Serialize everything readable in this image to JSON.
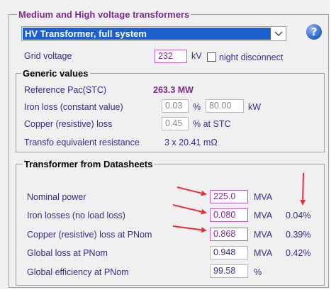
{
  "main_group": {
    "title": "Medium and High voltage transformers",
    "selected_transformer": "HV Transformer, full system",
    "grid_voltage_label": "Grid voltage",
    "grid_voltage_value": "232",
    "grid_voltage_unit": "kV",
    "night_disconnect_label": "night disconnect",
    "night_disconnect_checked": false,
    "help_glyph": "?"
  },
  "generic_values": {
    "title": "Generic values",
    "reference_pac_label": "Reference Pac(STC)",
    "reference_pac_value": "263.3 MW",
    "iron_loss_label": "Iron loss (constant value)",
    "iron_loss_pct": "0.03",
    "iron_loss_pct_unit": "%",
    "iron_loss_kw": "80.00",
    "iron_loss_kw_unit": "kW",
    "copper_loss_label": "Copper (resistive) loss",
    "copper_loss_pct": "0.45",
    "copper_loss_unit": "% at STC",
    "transfo_resistance_label": "Transfo equivalent resistance",
    "transfo_resistance_value": "3 x 20.41 mΩ"
  },
  "datasheets": {
    "title": "Transformer from Datasheets",
    "rows": [
      {
        "label": "Nominal power",
        "value": "225.0",
        "unit": "MVA",
        "pct": ""
      },
      {
        "label": "Iron losses (no load loss)",
        "value": "0.080",
        "unit": "MVA",
        "pct": "0.04%"
      },
      {
        "label": "Copper (resistive) loss at PNom",
        "value": "0.868",
        "unit": "MVA",
        "pct": "0.39%"
      },
      {
        "label": "Global loss at PNom",
        "value": "0.948",
        "unit": "MVA",
        "pct": "0.42%"
      },
      {
        "label": "Global efficiency at PNom",
        "value": "99.58",
        "unit": "%",
        "pct": ""
      }
    ]
  },
  "colors": {
    "group_title": "#7a2b8c",
    "label_text": "#3a2a8a",
    "selection": "#1e5fd0",
    "annotation_arrow": "#e8303a"
  },
  "icons": {
    "help": "help-icon",
    "dropdown": "chevron-down-icon"
  }
}
